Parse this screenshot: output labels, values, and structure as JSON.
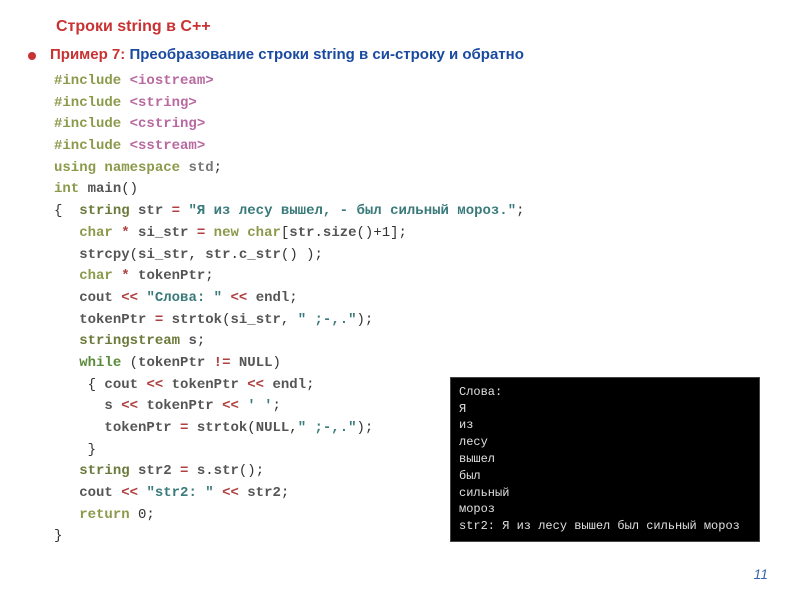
{
  "title": "Строки  string в С++",
  "example_label": "Пример 7:",
  "example_text": " Преобразование строки string в си-строку и обратно",
  "code": {
    "l01a": "#include ",
    "l01b": "<iostream>",
    "l02a": "#include ",
    "l02b": "<string>",
    "l03a": "#include ",
    "l03b": "<cstring>",
    "l04a": "#include ",
    "l04b": "<sstream>",
    "l05a": "using ",
    "l05b": "namespace ",
    "l05c": "std",
    "l05d": ";",
    "l06a": "int ",
    "l06b": "main",
    "l06c": "()",
    "l07a": "{  ",
    "l07b": "string ",
    "l07c": "str ",
    "l07d": "= ",
    "l07e": "\"Я из лесу вышел, - был сильный мороз.\"",
    "l07f": ";",
    "l08a": "   ",
    "l08b": "char ",
    "l08c": "* ",
    "l08d": "si_str ",
    "l08e": "= ",
    "l08f": "new ",
    "l08g": "char",
    "l08h": "[",
    "l08i": "str",
    "l08j": ".",
    "l08k": "size",
    "l08l": "()+1];",
    "l09a": "   ",
    "l09b": "strcpy",
    "l09c": "(",
    "l09d": "si_str",
    "l09e": ", ",
    "l09f": "str",
    "l09g": ".",
    "l09h": "c_str",
    "l09i": "() );",
    "l10a": "   ",
    "l10b": "char ",
    "l10c": "* ",
    "l10d": "tokenPtr",
    "l10e": ";",
    "l11a": "   ",
    "l11b": "cout ",
    "l11c": "<< ",
    "l11d": "\"Слова: \"",
    "l11e": " << ",
    "l11f": "endl",
    "l11g": ";",
    "l12a": "   ",
    "l12b": "tokenPtr ",
    "l12c": "= ",
    "l12d": "strtok",
    "l12e": "(",
    "l12f": "si_str",
    "l12g": ", ",
    "l12h": "\" ;-,.\"",
    "l12i": ");",
    "l13a": "   ",
    "l13b": "stringstream ",
    "l13c": "s",
    "l13d": ";",
    "l14a": "   ",
    "l14b": "while ",
    "l14c": "(",
    "l14d": "tokenPtr ",
    "l14e": "!= ",
    "l14f": "NULL",
    "l14g": ")",
    "l15a": "    { ",
    "l15b": "cout ",
    "l15c": "<< ",
    "l15d": "tokenPtr ",
    "l15e": "<< ",
    "l15f": "endl",
    "l15g": ";",
    "l16a": "      ",
    "l16b": "s ",
    "l16c": "<< ",
    "l16d": "tokenPtr ",
    "l16e": "<< ",
    "l16f": "' '",
    "l16g": ";",
    "l17a": "      ",
    "l17b": "tokenPtr ",
    "l17c": "= ",
    "l17d": "strtok",
    "l17e": "(",
    "l17f": "NULL",
    "l17g": ",",
    "l17h": "\" ;-,.\"",
    "l17i": ");",
    "l18a": "    }",
    "l19a": "   ",
    "l19b": "string ",
    "l19c": "str2 ",
    "l19d": "= ",
    "l19e": "s",
    "l19f": ".",
    "l19g": "str",
    "l19h": "();",
    "l20a": "   ",
    "l20b": "cout ",
    "l20c": "<< ",
    "l20d": "\"str2: \"",
    "l20e": " << ",
    "l20f": "str2",
    "l20g": ";",
    "l21a": "   ",
    "l21b": "return ",
    "l21c": "0;",
    "l22a": "}"
  },
  "output": "Слова:\nЯ\nиз\nлесу\nвышел\nбыл\nсильный\nмороз\nstr2: Я из лесу вышел был сильный мороз",
  "page_number": "11"
}
